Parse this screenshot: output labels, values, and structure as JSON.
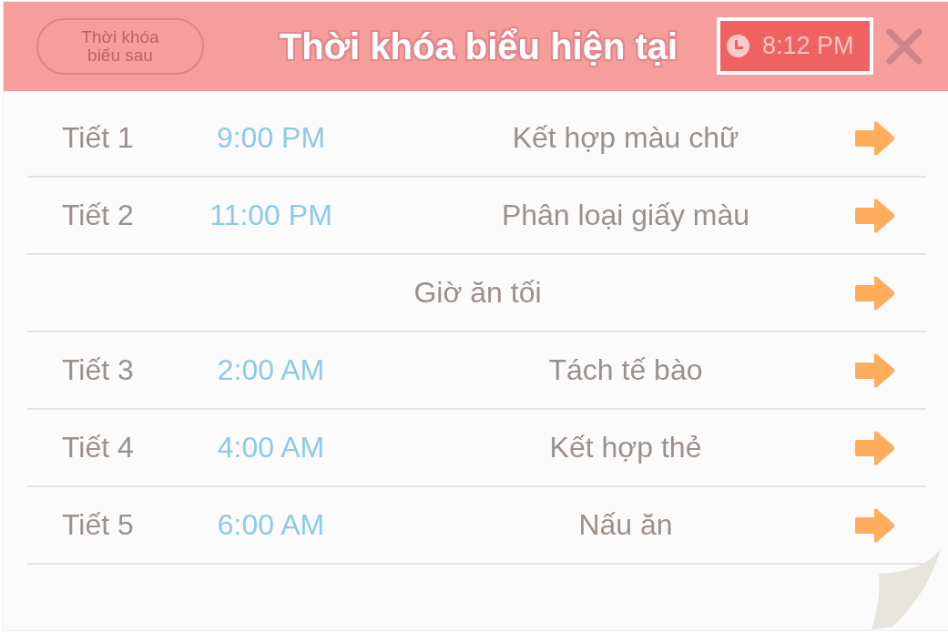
{
  "header": {
    "next_button": "Thời khóa biểu sau",
    "title": "Thời khóa biểu hiện tại",
    "clock": "8:12 PM"
  },
  "rows": [
    {
      "kind": "lesson",
      "period": "Tiết 1",
      "time": "9:00 PM",
      "activity": "Kết hợp màu chữ"
    },
    {
      "kind": "lesson",
      "period": "Tiết 2",
      "time": "11:00 PM",
      "activity": "Phân loại giấy màu"
    },
    {
      "kind": "break",
      "activity": "Giờ ăn tối"
    },
    {
      "kind": "lesson",
      "period": "Tiết 3",
      "time": "2:00 AM",
      "activity": "Tách tế bào"
    },
    {
      "kind": "lesson",
      "period": "Tiết 4",
      "time": "4:00 AM",
      "activity": "Kết hợp thẻ"
    },
    {
      "kind": "lesson",
      "period": "Tiết 5",
      "time": "6:00 AM",
      "activity": "Nấu ăn"
    }
  ]
}
